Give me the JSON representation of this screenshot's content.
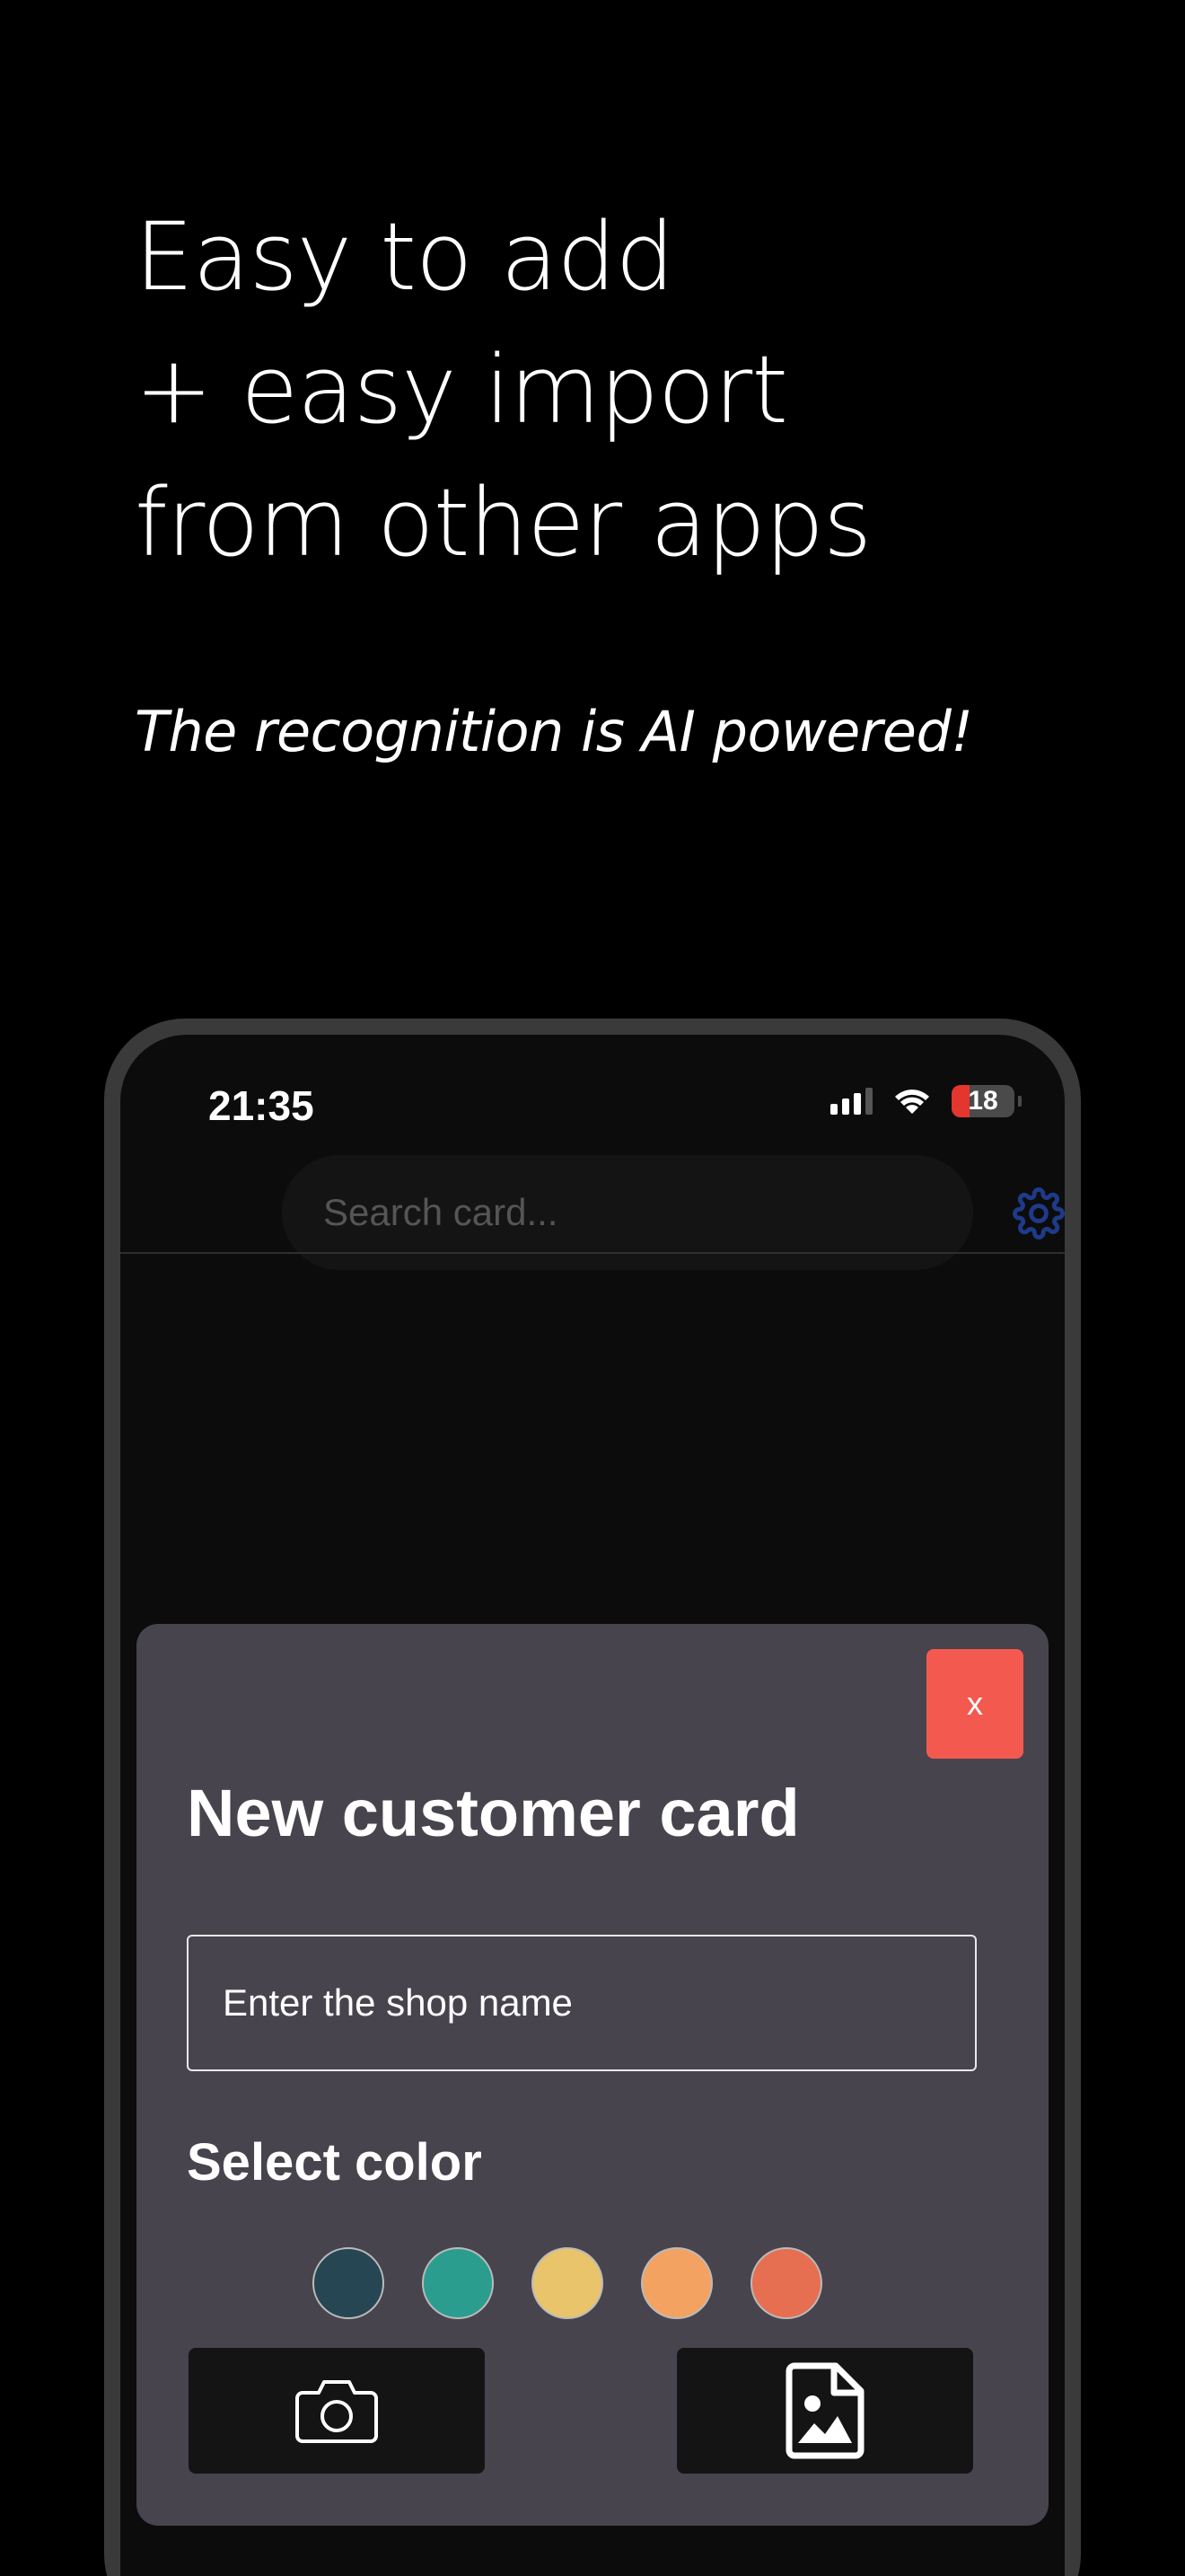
{
  "headline": {
    "line1": "Easy to add",
    "line2": "+ easy import",
    "line3": "from other apps"
  },
  "subheadline": "The recognition is AI powered!",
  "status_bar": {
    "time": "21:35",
    "battery": "18"
  },
  "search": {
    "placeholder": "Search card..."
  },
  "modal": {
    "close_label": "x",
    "title": "New customer card",
    "shop_placeholder": "Enter the shop name",
    "select_color_label": "Select color",
    "colors": [
      "#264653",
      "#2a9d8f",
      "#e9c46a",
      "#f4a261",
      "#e76f51"
    ]
  },
  "theme": {
    "background": "#000000",
    "modal_background": "#47444e",
    "close_button": "#f4594f",
    "settings_icon": "#1e3a8a",
    "action_button": "#141414"
  },
  "icons": {
    "settings": "gear-icon",
    "camera": "camera-icon",
    "image_file": "image-file-icon",
    "wifi": "wifi-icon",
    "signal": "signal-icon",
    "battery": "battery-icon"
  }
}
